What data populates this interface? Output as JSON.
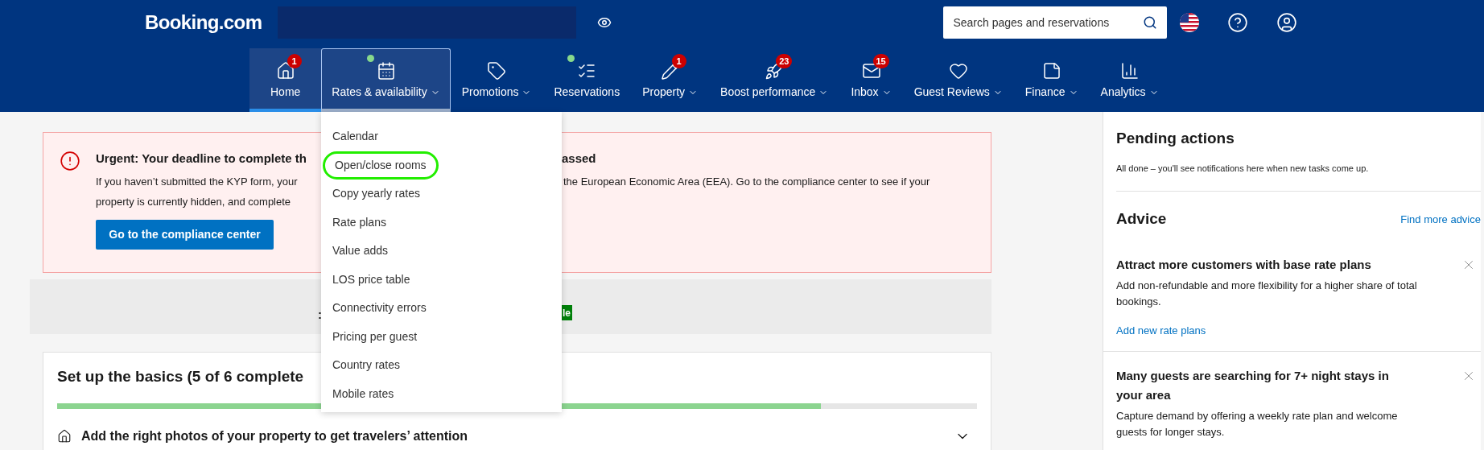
{
  "header": {
    "logo": "Booking.com",
    "search": {
      "placeholder": "Search pages and reservations"
    }
  },
  "nav": [
    {
      "label": "Home",
      "badge": "1",
      "dot": false,
      "chevron": false,
      "selected": true,
      "expanded": false
    },
    {
      "label": "Rates & availability",
      "dot": true,
      "chevron": true,
      "selected": false,
      "expanded": true
    },
    {
      "label": "Promotions",
      "dot": false,
      "chevron": true,
      "selected": false,
      "expanded": false
    },
    {
      "label": "Reservations",
      "dot": true,
      "chevron": false,
      "selected": false,
      "expanded": false
    },
    {
      "label": "Property",
      "badge": "1",
      "dot": false,
      "chevron": true,
      "selected": false,
      "expanded": false
    },
    {
      "label": "Boost performance",
      "badge": "23",
      "dot": false,
      "chevron": true,
      "selected": false,
      "expanded": false
    },
    {
      "label": "Inbox",
      "badge": "15",
      "dot": false,
      "chevron": true,
      "selected": false,
      "expanded": false
    },
    {
      "label": "Guest Reviews",
      "dot": false,
      "chevron": true,
      "selected": false,
      "expanded": false
    },
    {
      "label": "Finance",
      "dot": false,
      "chevron": true,
      "selected": false,
      "expanded": false
    },
    {
      "label": "Analytics",
      "dot": false,
      "chevron": true,
      "selected": false,
      "expanded": false
    }
  ],
  "dropdown": [
    {
      "label": "Calendar",
      "circled": false
    },
    {
      "label": "Open/close rooms",
      "circled": true
    },
    {
      "label": "Copy yearly rates",
      "circled": false
    },
    {
      "label": "Rate plans",
      "circled": false
    },
    {
      "label": "Value adds",
      "circled": false
    },
    {
      "label": "LOS price table",
      "circled": false
    },
    {
      "label": "Connectivity errors",
      "circled": false
    },
    {
      "label": "Pricing per guest",
      "circled": false
    },
    {
      "label": "Country rates",
      "circled": false
    },
    {
      "label": "Mobile rates",
      "circled": false
    }
  ],
  "alert": {
    "title_start": "Urgent: Your deadline to complete th",
    "title_end": "assed",
    "body_line1_start": "If you haven’t submitted the KYP form, your",
    "body_line1_end": "the European Economic Area (EEA). Go to the compliance center to see if your",
    "body_line2_start": "property is currently hidden, and complete",
    "button": "Go to the compliance center"
  },
  "banner": {
    "text": ":",
    "badge": "le"
  },
  "setup": {
    "title": "Set up the basics (5 of 6 complete",
    "level": 0.83,
    "task": "Add the right photos of your property to get travelers’ attention"
  },
  "pending": {
    "title": "Pending actions",
    "message": "All done – you'll see notifications here when new tasks come up."
  },
  "advice": {
    "title": "Advice",
    "link": "Find more advice",
    "cards": [
      {
        "title": "Attract more customers with base rate plans",
        "text": "Add non-refundable and more flexibility for a higher share of total bookings.",
        "link": "Add new rate plans"
      },
      {
        "title": "Many guests are searching for 7+ night stays in your area",
        "text": "Capture demand by offering a weekly rate plan and welcome guests for longer stays."
      }
    ]
  }
}
